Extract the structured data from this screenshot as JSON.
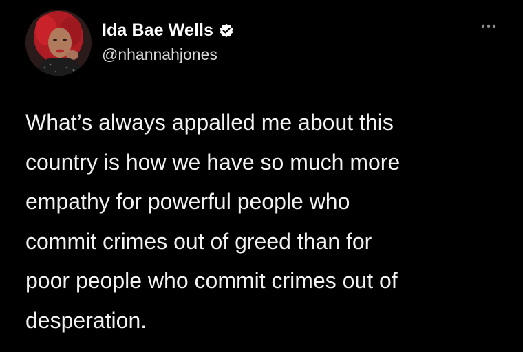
{
  "tweet": {
    "author": {
      "display_name": "Ida Bae Wells",
      "handle": "@nhannahjones",
      "verified": true,
      "avatar_icon": "profile-photo"
    },
    "text": "What’s always appalled me about this\ncountry is how we have so much more\nempathy for powerful people who\ncommit crimes out of greed than for\npoor people who commit crimes out of\ndesperation.",
    "more_icon": "more-options-icon"
  },
  "colors": {
    "background": "#000000",
    "text": "#f2f2f2",
    "handle": "#d9d9d9",
    "verified_badge": "#ffffff"
  }
}
